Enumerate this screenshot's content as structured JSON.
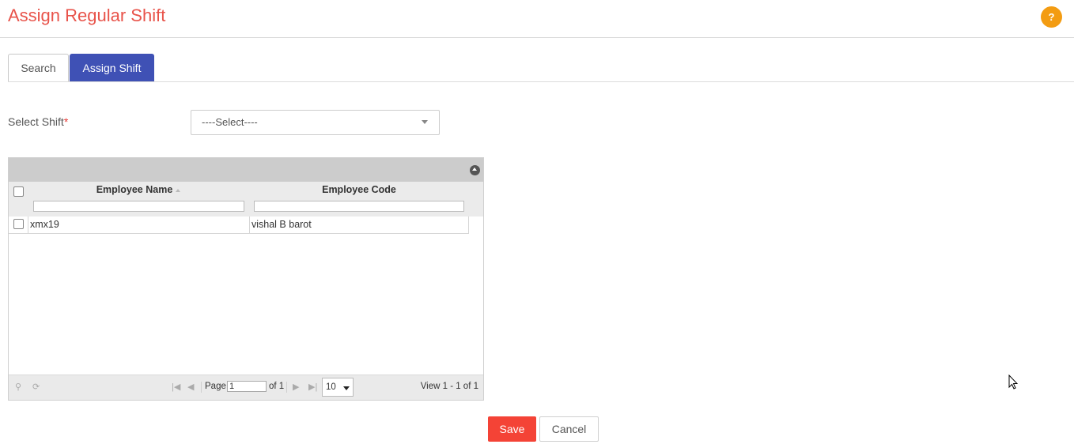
{
  "header": {
    "title": "Assign Regular Shift",
    "help_label": "?"
  },
  "tabs": [
    {
      "label": "Search",
      "active": false
    },
    {
      "label": "Assign Shift",
      "active": true
    }
  ],
  "form": {
    "select_shift_label": "Select Shift",
    "required_marker": "*",
    "select_shift_value": "----Select----"
  },
  "grid": {
    "columns": [
      "Employee Name",
      "Employee Code"
    ],
    "rows": [
      {
        "employee_name": "xmx19",
        "employee_code": "vishal B barot"
      }
    ],
    "pager": {
      "page_label": "Page",
      "page_value": "1",
      "of_label": "of 1",
      "page_size": "10",
      "view_text": "View 1 - 1 of 1"
    }
  },
  "actions": {
    "save_label": "Save",
    "cancel_label": "Cancel"
  },
  "colors": {
    "title": "#e8534a",
    "active_tab": "#3f51b5",
    "save_button": "#f44336",
    "help_button": "#f39c12"
  },
  "icons": [
    "help-icon",
    "collapse-icon",
    "sort-icon",
    "search-icon",
    "refresh-icon",
    "first-page-icon",
    "prev-page-icon",
    "next-page-icon",
    "last-page-icon",
    "dropdown-caret-icon",
    "mouse-cursor-icon"
  ]
}
